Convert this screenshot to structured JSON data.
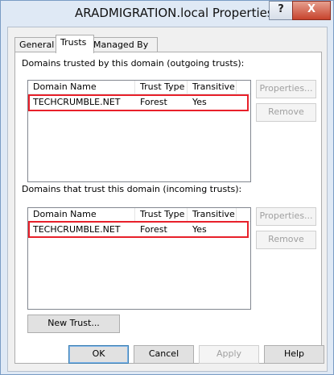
{
  "window": {
    "title": "ARADMIGRATION.local Properties",
    "help_button": "?",
    "close_button": "X"
  },
  "tabs": [
    {
      "label": "General",
      "active": false
    },
    {
      "label": "Trusts",
      "active": true
    },
    {
      "label": "Managed By",
      "active": false
    }
  ],
  "outgoing": {
    "label": "Domains trusted by this domain (outgoing trusts):",
    "columns": [
      "Domain Name",
      "Trust Type",
      "Transitive"
    ],
    "rows": [
      {
        "domain": "TECHCRUMBLE.NET",
        "type": "Forest",
        "transitive": "Yes"
      }
    ],
    "properties_button": "Properties...",
    "remove_button": "Remove"
  },
  "incoming": {
    "label": "Domains that trust this domain (incoming trusts):",
    "columns": [
      "Domain Name",
      "Trust Type",
      "Transitive"
    ],
    "rows": [
      {
        "domain": "TECHCRUMBLE.NET",
        "type": "Forest",
        "transitive": "Yes"
      }
    ],
    "properties_button": "Properties...",
    "remove_button": "Remove"
  },
  "new_trust_button": "New Trust...",
  "footer": {
    "ok": "OK",
    "cancel": "Cancel",
    "apply": "Apply",
    "help": "Help"
  },
  "colors": {
    "highlight": "#e8202a",
    "titlebar": "#dfe9f5"
  }
}
